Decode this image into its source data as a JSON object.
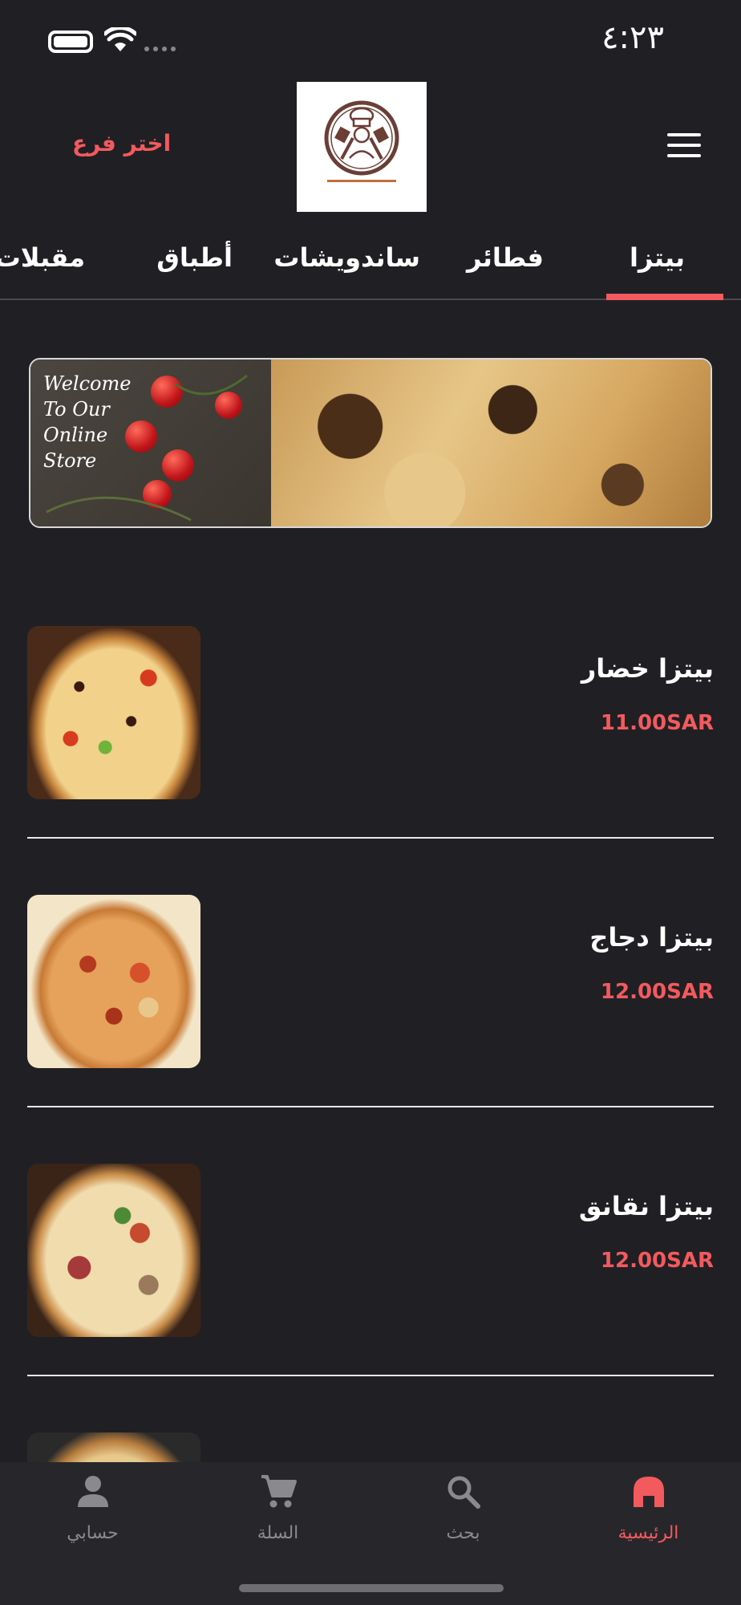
{
  "theme": {
    "accent": "#f25a5e",
    "background": "#202024",
    "nav_background": "#27272b"
  },
  "status_bar": {
    "time": "٤:٢٣"
  },
  "header": {
    "branch_label": "اختر فرع",
    "menu_icon": "hamburger-icon",
    "logo_alt": "restaurant-logo"
  },
  "banner": {
    "text": "Welcome To Our Online Store"
  },
  "tabs": [
    {
      "label": "بيتزا",
      "active": true
    },
    {
      "label": "فطائر",
      "active": false
    },
    {
      "label": "ساندويشات",
      "active": false
    },
    {
      "label": "أطباق",
      "active": false
    },
    {
      "label": "مقبلات",
      "active": false
    }
  ],
  "items": [
    {
      "name": "بيتزا خضار",
      "price": "11.00SAR"
    },
    {
      "name": "بيتزا دجاج",
      "price": "12.00SAR"
    },
    {
      "name": "بيتزا نقانق",
      "price": "12.00SAR"
    }
  ],
  "bottom_nav": [
    {
      "label": "الرئيسية",
      "icon": "home-icon",
      "active": true
    },
    {
      "label": "بحث",
      "icon": "search-icon",
      "active": false
    },
    {
      "label": "السلة",
      "icon": "cart-icon",
      "active": false
    },
    {
      "label": "حسابي",
      "icon": "person-icon",
      "active": false
    }
  ]
}
